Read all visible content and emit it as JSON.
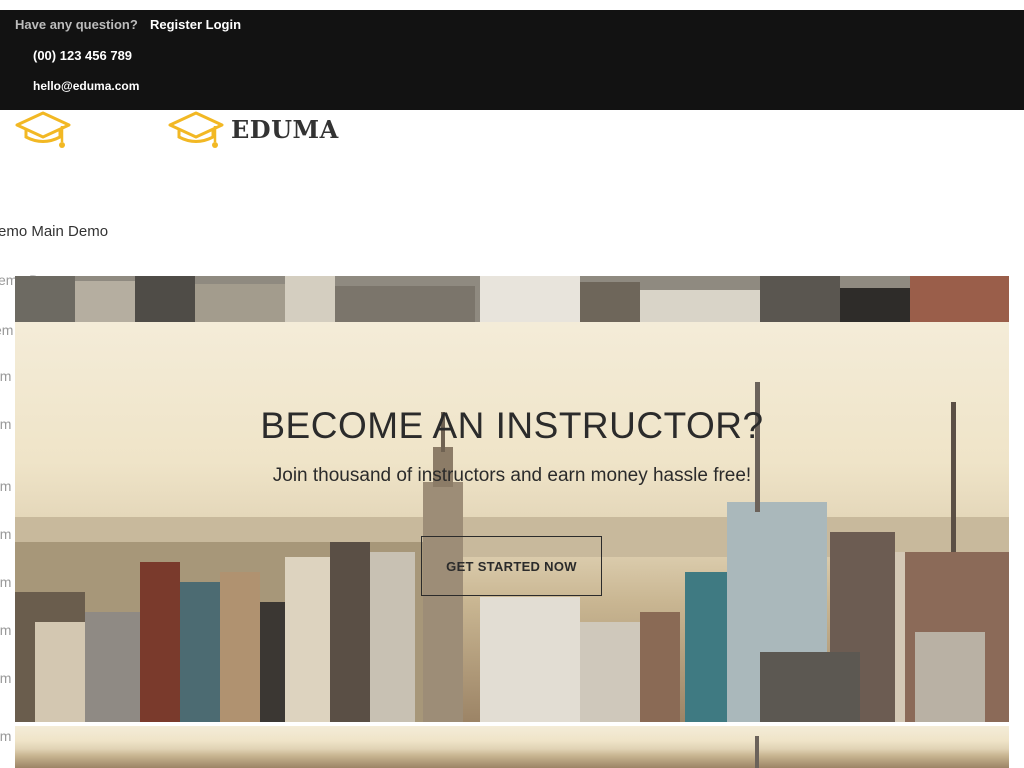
{
  "topbar": {
    "question": "Have any question?",
    "register": "Register",
    "login": "Login",
    "phone": "(00) 123 456 789",
    "email": "hello@eduma.com"
  },
  "brand": {
    "name": "EDUMA",
    "accent": "#f2b824",
    "icon": "graduation-cap-icon"
  },
  "menu": {
    "main_demo": "emo Main Demo",
    "faded_items": [
      "emo Demo",
      "em",
      "em",
      "em",
      "em",
      "em",
      "em",
      "em",
      "em",
      "em"
    ]
  },
  "hero": {
    "title": "BECOME AN INSTRUCTOR?",
    "subtitle": "Join thousand of instructors and earn money hassle free!",
    "button": "GET STARTED NOW"
  },
  "colors": {
    "topbar_bg": "#121212",
    "text_dark": "#2b2b2b"
  }
}
